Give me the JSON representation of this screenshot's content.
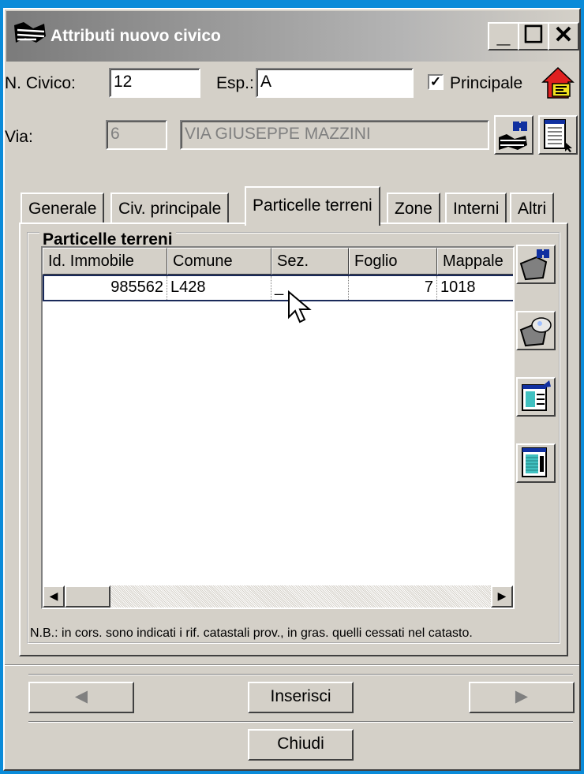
{
  "window": {
    "title": "Attributi nuovo civico",
    "controls": {
      "minimize": "_",
      "maximize": "☐",
      "close": "✕"
    }
  },
  "form": {
    "civico_label": "N. Civico:",
    "civico_value": "12",
    "esp_label": "Esp.:",
    "esp_value": "A",
    "principale_label": "Principale",
    "principale_checked": "✓",
    "via_label": "Via:",
    "via_code": "6",
    "via_name": "VIA GIUSEPPE MAZZINI"
  },
  "tabs": [
    {
      "label": "Generale"
    },
    {
      "label": "Civ. principale"
    },
    {
      "label": "Particelle terreni"
    },
    {
      "label": "Zone"
    },
    {
      "label": "Interni"
    },
    {
      "label": "Altri"
    }
  ],
  "active_tab": "Particelle terreni",
  "group": {
    "title": "Particelle terreni",
    "columns": [
      "Id. Immobile",
      "Comune",
      "Sez.",
      "Foglio",
      "Mappale"
    ],
    "rows": [
      {
        "id": "985562",
        "comune": "L428",
        "sez": "_",
        "foglio": "7",
        "mappale": "1018"
      }
    ],
    "note": "N.B.: in cors. sono indicati i rif. catastali prov., in gras. quelli cessati nel catasto."
  },
  "scroll": {
    "left": "◀",
    "right": "▶"
  },
  "buttons": {
    "prev": "◀",
    "insert": "Inserisci",
    "next": "▶",
    "close": "Chiudi"
  },
  "icons": {
    "title": "map-roads-icon",
    "house": "house-icon",
    "search_street": "binoculars-map-icon",
    "doc_select": "document-cursor-icon",
    "find_parcel": "binoculars-parcel-icon",
    "view_parcel": "parcel-view-icon",
    "edit_record": "record-export-icon",
    "record_details": "record-details-icon"
  },
  "colors": {
    "desktop": "#0a8bd9",
    "window": "#d4d0c8",
    "house_red": "#e02020",
    "house_yellow": "#f0e020"
  }
}
